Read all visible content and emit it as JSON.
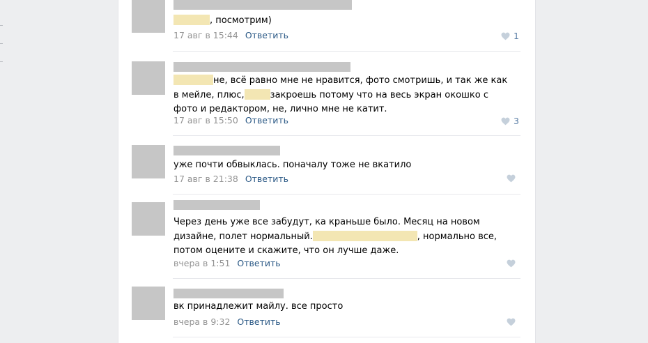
{
  "comments": [
    {
      "text_after_redact": ", посмотрим)",
      "date": "17 авг в 15:44",
      "reply": "Ответить",
      "likes": "1"
    },
    {
      "text_part1": "не, всё равно мне не нравится, фото смотришь, и так же как в мейле, плюс,",
      "text_part2": "закроешь потому что на весь экран окошко с фото и редактором, не, лично мне не катит.",
      "date": "17 авг в 15:50",
      "reply": "Ответить",
      "likes": "3"
    },
    {
      "text": "уже почти обвыклась. поначалу тоже не вкатило",
      "date": "17 авг в 21:38",
      "reply": "Ответить",
      "likes": ""
    },
    {
      "text_part1": "Через день уже все забудут, ка краньше было. Месяц на новом дизайне, полет нормальный.",
      "text_part2": ", нормально все, потом оцените и скажите, что он лучше даже.",
      "date": "вчера в 1:51",
      "reply": "Ответить",
      "likes": ""
    },
    {
      "text": "вк принадлежит майлу. все просто",
      "date": "вчера в 9:32",
      "reply": "Ответить",
      "likes": ""
    }
  ],
  "colors": {
    "page_bg": "#edeef0",
    "link": "#2a5885",
    "meta": "#939393",
    "like": "#5b7fa6",
    "heart": "#c5d0db"
  }
}
